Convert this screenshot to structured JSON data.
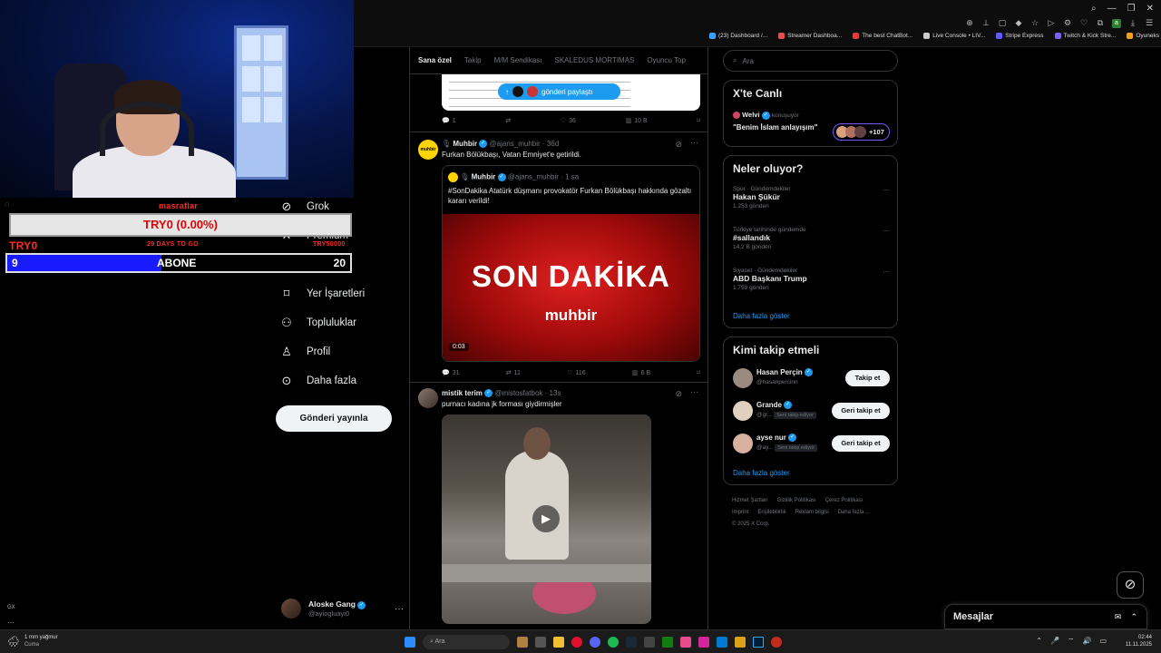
{
  "browser": {
    "bookmarks": [
      {
        "label": "(23) Dashboard /...",
        "color": "#3aa0ff"
      },
      {
        "label": "Streamer Dashboa...",
        "color": "#e05050"
      },
      {
        "label": "The best ChatBot...",
        "color": "#e03c3c"
      },
      {
        "label": "Live Console • LIV...",
        "color": "#cccccc"
      },
      {
        "label": "Stripe Express",
        "color": "#635bff"
      },
      {
        "label": "Twitch & Kick Stre...",
        "color": "#7a5cff"
      },
      {
        "label": "Oyuneks - Türkiye...",
        "color": "#f0a020"
      }
    ]
  },
  "stream_overlay": {
    "top_label": "masraflar",
    "ticker_value": "TRY0 (0.00%)",
    "left_amount": "TRY0",
    "countdown": "29 DAYS TO GO",
    "right_amount": "TRY50000",
    "sub_current": "9",
    "sub_label": "ABONE",
    "sub_goal": "20",
    "sub_progress": 0.45
  },
  "sidebar": {
    "items": [
      {
        "label": "Grok",
        "icon": "grok-icon"
      },
      {
        "label": "Premium",
        "icon": "x-icon"
      },
      {
        "label": "Listeler",
        "icon": "list-icon"
      },
      {
        "label": "Yer İşaretleri",
        "icon": "bookmark-icon"
      },
      {
        "label": "Topluluklar",
        "icon": "communities-icon"
      },
      {
        "label": "Profil",
        "icon": "profile-icon"
      },
      {
        "label": "Daha fazla",
        "icon": "more-icon"
      }
    ],
    "post_button": "Gönderi yayınla",
    "account": {
      "name": "Aloske Gang",
      "handle": "@ayiogluayi0"
    }
  },
  "feed": {
    "tabs": [
      "Sana özel",
      "Takip",
      "M/M Sendikası",
      "SKALEDUS MORTIMAS",
      "Oyuncu Top"
    ],
    "share_pill": "gönderi paylaştı",
    "post0_actions": {
      "replies": "1",
      "reposts": "",
      "likes": "36",
      "views": "10 B"
    },
    "post1": {
      "name": "Muhbir",
      "handle": "@ajans_muhbir",
      "time": "36d",
      "text": "Furkan Bölükbaşı, Vatan Emniyet'e getirildi.",
      "quote": {
        "name": "Muhbir",
        "handle": "@ajans_muhbir",
        "time": "1 sa",
        "text": "#SonDakika Atatürk düşmanı provokatör Furkan Bölükbaşı hakkında gözaltı kararı verildi!",
        "video_title": "SON DAKİKA",
        "video_brand": "muhbir",
        "video_duration": "0:03"
      },
      "actions": {
        "replies": "31",
        "reposts": "11",
        "likes": "116",
        "views": "6 B"
      }
    },
    "post2": {
      "name": "mistik terim",
      "handle": "@mistosfatbok",
      "time": "13s",
      "text": "purnacı kadına jk forması giydirmişler"
    }
  },
  "right": {
    "search_placeholder": "Ara",
    "live": {
      "title": "X'te Canlı",
      "host": "Welvi",
      "host_status": "konuşuyor",
      "space_title": "\"Benim İslam anlayışım\"",
      "listeners": "+107"
    },
    "trends": {
      "title": "Neler oluyor?",
      "items": [
        {
          "meta": "Spor · Gündemdekiler",
          "name": "Hakan Şükür",
          "count": "1.253 gönderi"
        },
        {
          "meta": "Türkiye tarihinde gündemde",
          "name": "#sallandık",
          "count": "14,2 B gönderi"
        },
        {
          "meta": "Siyaset · Gündemdekiler",
          "name": "ABD Başkanı Trump",
          "count": "1.759 gönderi"
        }
      ],
      "show_more": "Daha fazla göster"
    },
    "who_to_follow": {
      "title": "Kimi takip etmeli",
      "items": [
        {
          "name": "Hasan Perçin",
          "handle": "@hasanpercinn",
          "button": "Takip et",
          "follows_you": ""
        },
        {
          "name": "Grande",
          "handle": "@gr...",
          "button": "Geri takip et",
          "follows_you": "Seni takip ediyor"
        },
        {
          "name": "ayse nur",
          "handle": "@ay...",
          "button": "Geri takip et",
          "follows_you": "Seni takip ediyor"
        }
      ],
      "show_more": "Daha fazla göster"
    },
    "footer": [
      "Hizmet Şartları",
      "Gizlilik Politikası",
      "Çerez Politikası",
      "Imprint",
      "Erişilebilirlik",
      "Reklam bilgisi",
      "Daha fazla ...",
      "© 2025 X Corp."
    ],
    "messages": "Mesajlar"
  },
  "taskbar": {
    "weather_temp": "1 mm yağmur",
    "weather_day": "Cuma",
    "search": "Ara",
    "time": "02:44",
    "date": "11.11.2025"
  },
  "misc": {
    "gx_label": "GX"
  }
}
